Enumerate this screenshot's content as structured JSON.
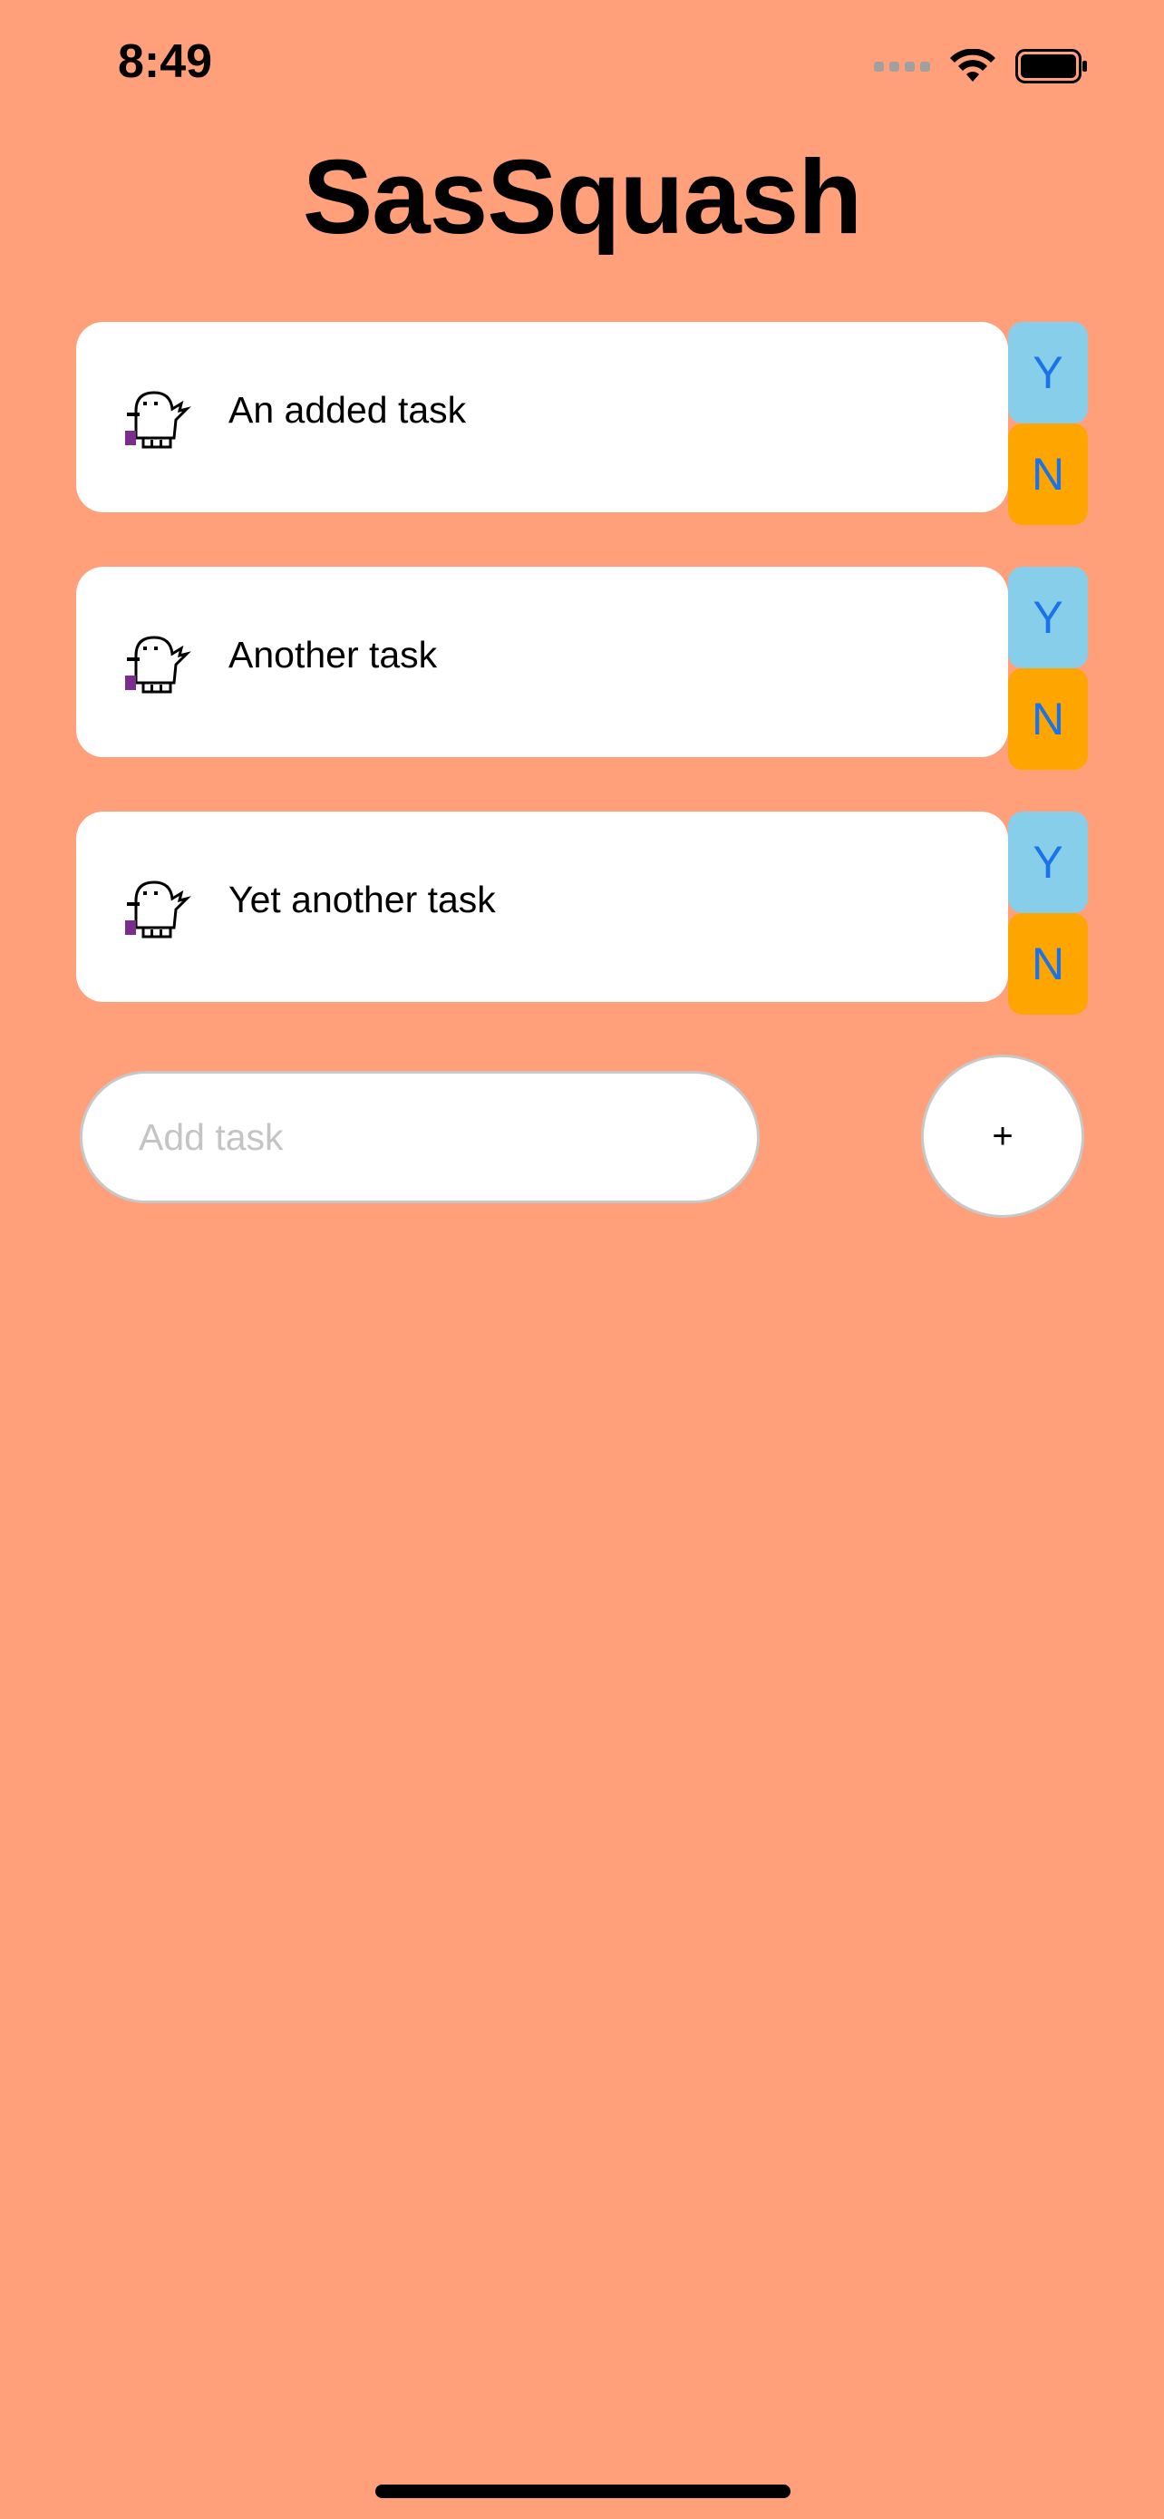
{
  "status_bar": {
    "time": "8:49"
  },
  "app": {
    "title": "SasSquash",
    "background_color": "#FFA07A"
  },
  "tasks": [
    {
      "label": "An added task",
      "yes_label": "Y",
      "no_label": "N",
      "avatar_icon": "sasquatch-icon"
    },
    {
      "label": "Another task",
      "yes_label": "Y",
      "no_label": "N",
      "avatar_icon": "sasquatch-icon"
    },
    {
      "label": "Yet another task",
      "yes_label": "Y",
      "no_label": "N",
      "avatar_icon": "sasquatch-icon"
    }
  ],
  "add_task": {
    "placeholder": "Add task",
    "button_label": "+"
  },
  "colors": {
    "yes_button": "#87CEEB",
    "no_button": "#FFA500",
    "button_text": "#1a73e8"
  }
}
